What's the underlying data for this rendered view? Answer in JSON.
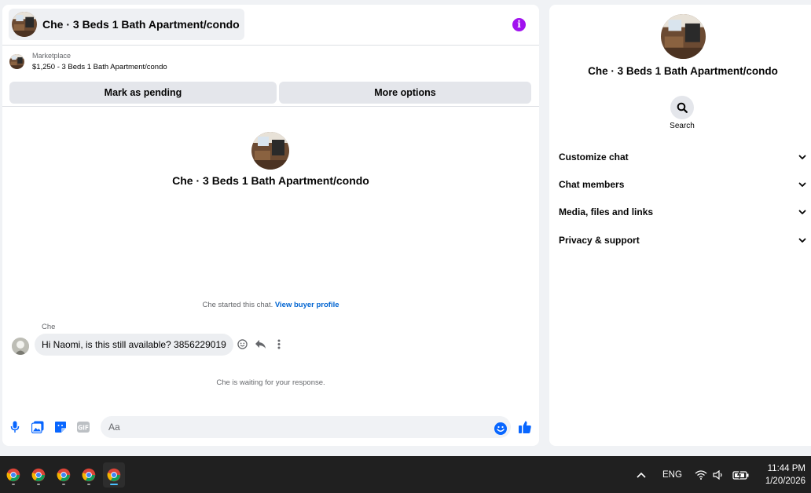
{
  "chat": {
    "title": "Che · 3 Beds 1 Bath Apartment/condo",
    "info_icon": "info-icon",
    "listing": {
      "label": "Marketplace",
      "price_title": "$1,250 - 3 Beds 1 Bath Apartment/condo"
    },
    "actions": {
      "pending_label": "Mark as pending",
      "more_label": "More options"
    },
    "intro_title": "Che · 3 Beds 1 Bath Apartment/condo",
    "started_text": "Che started this chat.",
    "buyer_profile_link": "View buyer profile",
    "sender_name": "Che",
    "message_text": "Hi Naomi, is this still available? 3856229019",
    "waiting_text": "Che is waiting for your response.",
    "composer_placeholder": "Aa"
  },
  "side": {
    "title": "Che · 3 Beds 1 Bath Apartment/condo",
    "search_label": "Search",
    "sections": [
      {
        "label": "Customize chat"
      },
      {
        "label": "Chat members"
      },
      {
        "label": "Media, files and links"
      },
      {
        "label": "Privacy & support"
      }
    ]
  },
  "taskbar": {
    "apps": [
      "chrome-icon",
      "chrome-icon",
      "chrome-icon",
      "chrome-icon",
      "chrome-icon"
    ],
    "language": "ENG",
    "time": "11:44 PM",
    "date": "1/20/2026"
  },
  "colors": {
    "accent": "#0866ff",
    "info": "#a112ef",
    "link": "#0064d1"
  }
}
